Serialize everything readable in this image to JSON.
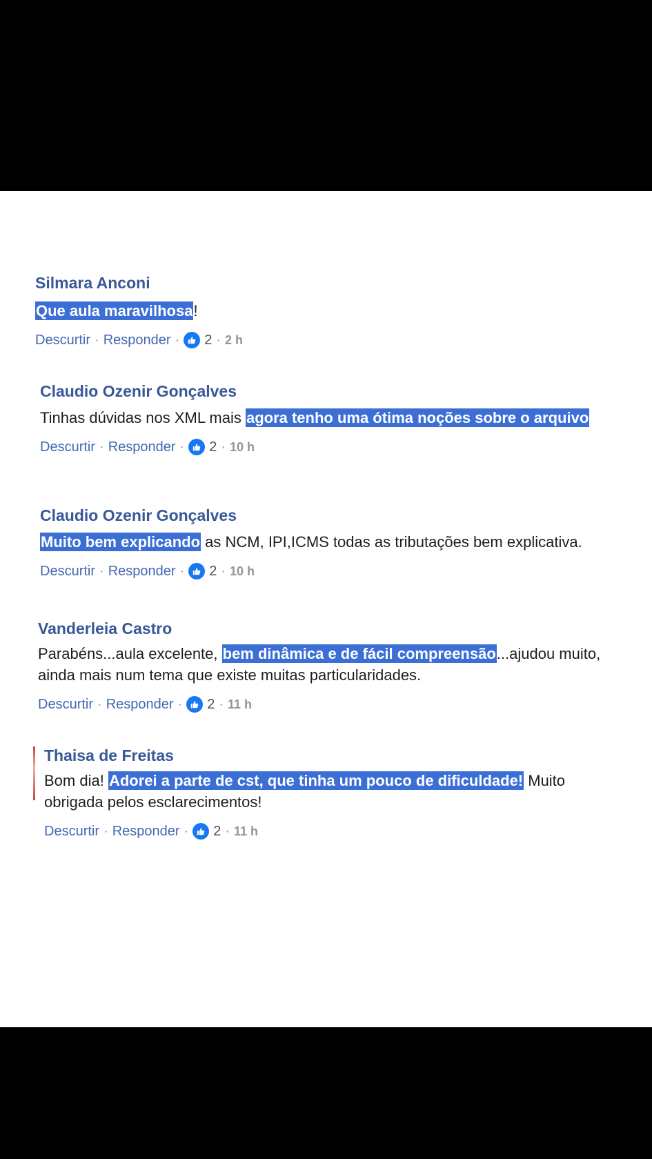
{
  "comments": [
    {
      "author": "Silmara Anconi",
      "text_before": "",
      "highlight": "Que aula maravilhosa",
      "text_after": "!",
      "actions": {
        "unlike": "Descurtir",
        "reply": "Responder",
        "likes": "2",
        "time": "2 h"
      }
    },
    {
      "author": "Claudio Ozenir Gonçalves",
      "text_before": "Tinhas dúvidas nos XML mais ",
      "highlight": "agora tenho uma ótima noções sobre o arquivo",
      "text_after": "",
      "actions": {
        "unlike": "Descurtir",
        "reply": "Responder",
        "likes": "2",
        "time": "10 h"
      }
    },
    {
      "author": "Claudio Ozenir Gonçalves",
      "text_before": "",
      "highlight": "Muito bem explicando",
      "text_after": " as NCM, IPI,ICMS todas as tributações bem explicativa.",
      "actions": {
        "unlike": "Descurtir",
        "reply": "Responder",
        "likes": "2",
        "time": "10 h"
      }
    },
    {
      "author": "Vanderleia Castro",
      "text_before": "Parabéns...aula excelente, ",
      "highlight": "bem dinâmica e de fácil compreensão",
      "text_after": "...ajudou muito, ainda mais num tema que existe muitas particularidades.",
      "actions": {
        "unlike": "Descurtir",
        "reply": "Responder",
        "likes": "2",
        "time": "11 h"
      }
    },
    {
      "author": "Thaisa de Freitas",
      "text_before": "Bom dia! ",
      "highlight": "Adorei a parte de cst, que tinha um pouco de dificuldade!",
      "text_after": " Muito obrigada pelos esclarecimentos!",
      "actions": {
        "unlike": "Descurtir",
        "reply": "Responder",
        "likes": "2",
        "time": "11 h"
      }
    }
  ],
  "separator": "·",
  "icons": {
    "like": "like-thumbs-up-icon"
  },
  "colors": {
    "author": "#385898",
    "link": "#4267b2",
    "highlight": "#3b6fd6",
    "like_badge": "#1877f2"
  }
}
